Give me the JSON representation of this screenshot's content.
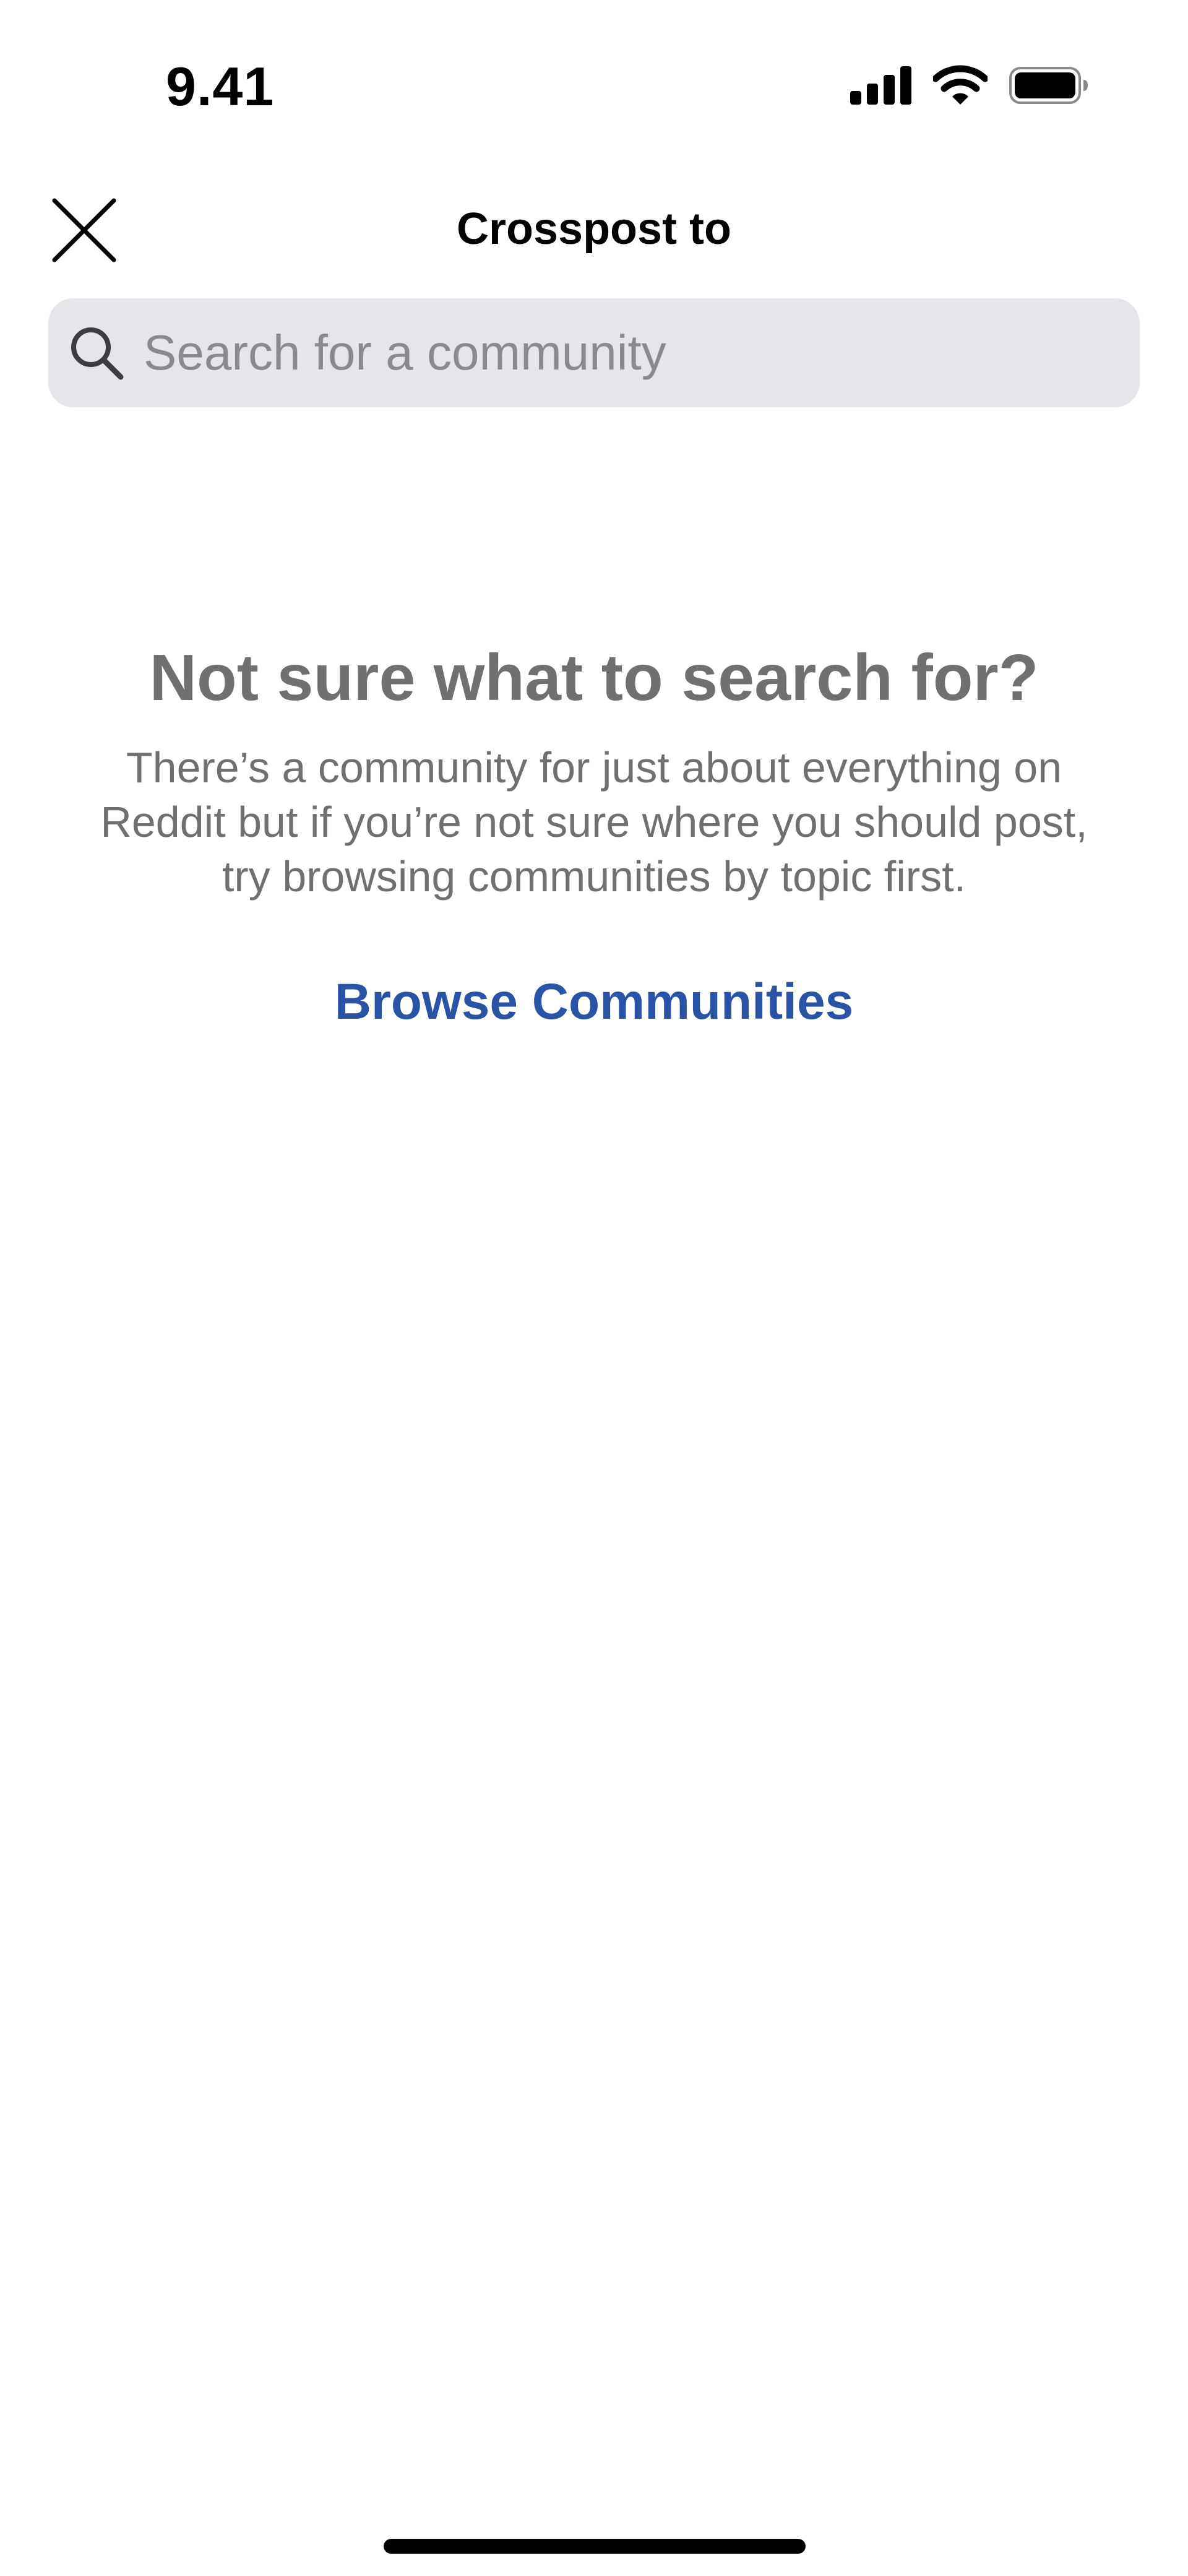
{
  "status_bar": {
    "time": "9.41",
    "icons": [
      "cellular-signal-icon",
      "wifi-icon",
      "battery-icon"
    ]
  },
  "header": {
    "title": "Crosspost to",
    "close_icon": "close-icon"
  },
  "search": {
    "placeholder": "Search for a community",
    "value": "",
    "icon": "search-icon"
  },
  "empty_state": {
    "heading": "Not sure what to search for?",
    "body_lines": [
      "There’s a community for just about everything on",
      "Reddit but if you’re not sure where you should post,",
      "try browsing communities by topic first."
    ],
    "link_label": "Browse Communities"
  },
  "colors": {
    "link": "#2a52a6",
    "muted_text": "#707070",
    "search_bg": "#e5e5ea",
    "placeholder": "#8a8a8e"
  }
}
